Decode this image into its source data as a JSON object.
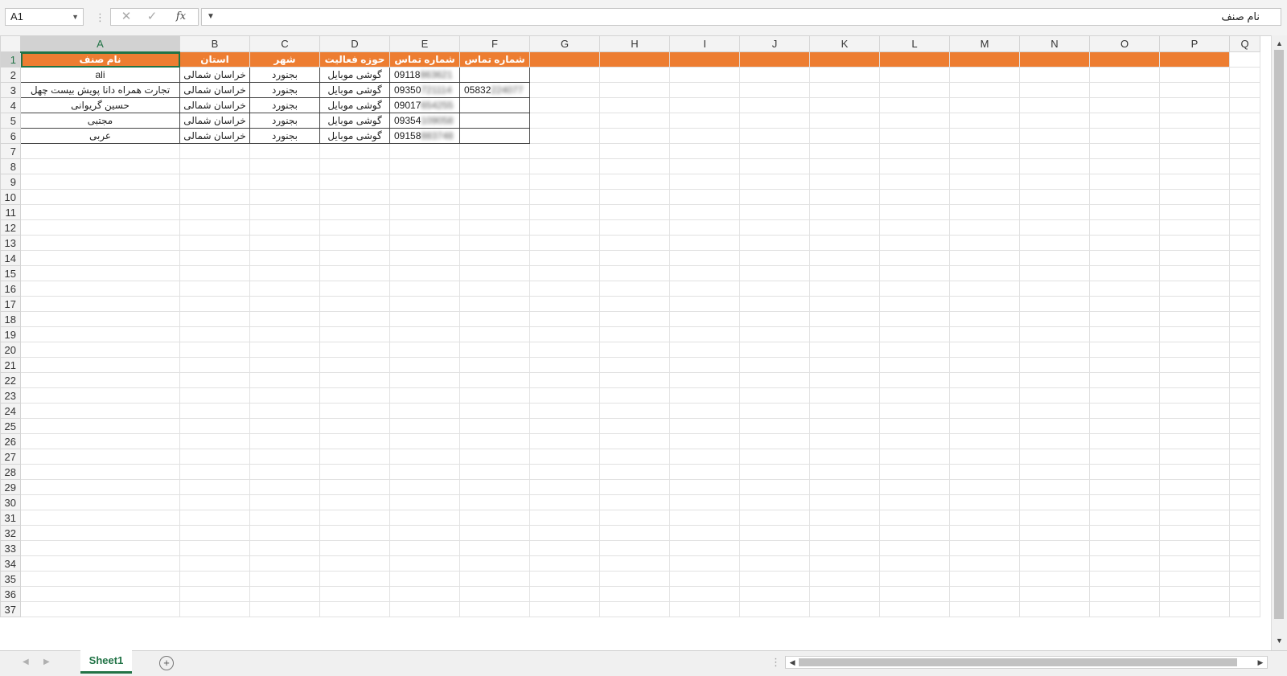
{
  "formula_bar": {
    "name_box": "A1",
    "content": "نام صنف",
    "cancel_icon": "✕",
    "enter_icon": "✓",
    "fx_label": "fx"
  },
  "columns": [
    "A",
    "B",
    "C",
    "D",
    "E",
    "F",
    "G",
    "H",
    "I",
    "J",
    "K",
    "L",
    "M",
    "N",
    "O",
    "P",
    "Q"
  ],
  "row_numbers": [
    1,
    2,
    3,
    4,
    5,
    6,
    7,
    8,
    9,
    10,
    11,
    12,
    13,
    14,
    15,
    16,
    17,
    18,
    19,
    20,
    21,
    22,
    23,
    24,
    25,
    26,
    27,
    28,
    29,
    30,
    31,
    32,
    33,
    34,
    35,
    36,
    37
  ],
  "headers": [
    "نام صنف",
    "استان",
    "شهر",
    "حوزه فعالیت",
    "شماره تماس",
    "شماره تماس"
  ],
  "rows": [
    {
      "name": "ali",
      "province": "خراسان شمالی",
      "city": "بجنورد",
      "activity": "گوشی موبایل",
      "phone1_visible": "09118",
      "phone1_blurred": "863621",
      "phone2_visible": "",
      "phone2_blurred": ""
    },
    {
      "name": "تجارت همراه دانا پویش بیست چهل",
      "province": "خراسان شمالی",
      "city": "بجنورد",
      "activity": "گوشی موبایل",
      "phone1_visible": "09350",
      "phone1_blurred": "721114",
      "phone2_visible": "05832",
      "phone2_blurred": "224077"
    },
    {
      "name": "حسین گریوانی",
      "province": "خراسان شمالی",
      "city": "بجنورد",
      "activity": "گوشی موبایل",
      "phone1_visible": "09017",
      "phone1_blurred": "654255",
      "phone2_visible": "",
      "phone2_blurred": ""
    },
    {
      "name": "مجتبی",
      "province": "خراسان شمالی",
      "city": "بجنورد",
      "activity": "گوشی موبایل",
      "phone1_visible": "09354",
      "phone1_blurred": "109058",
      "phone2_visible": "",
      "phone2_blurred": ""
    },
    {
      "name": "عربی",
      "province": "خراسان شمالی",
      "city": "بجنورد",
      "activity": "گوشی موبایل",
      "phone1_visible": "09158",
      "phone1_blurred": "883748",
      "phone2_visible": "",
      "phone2_blurred": ""
    }
  ],
  "sheet_tab": "Sheet1",
  "colors": {
    "header_fill": "#ed7d31",
    "accent": "#217346"
  }
}
